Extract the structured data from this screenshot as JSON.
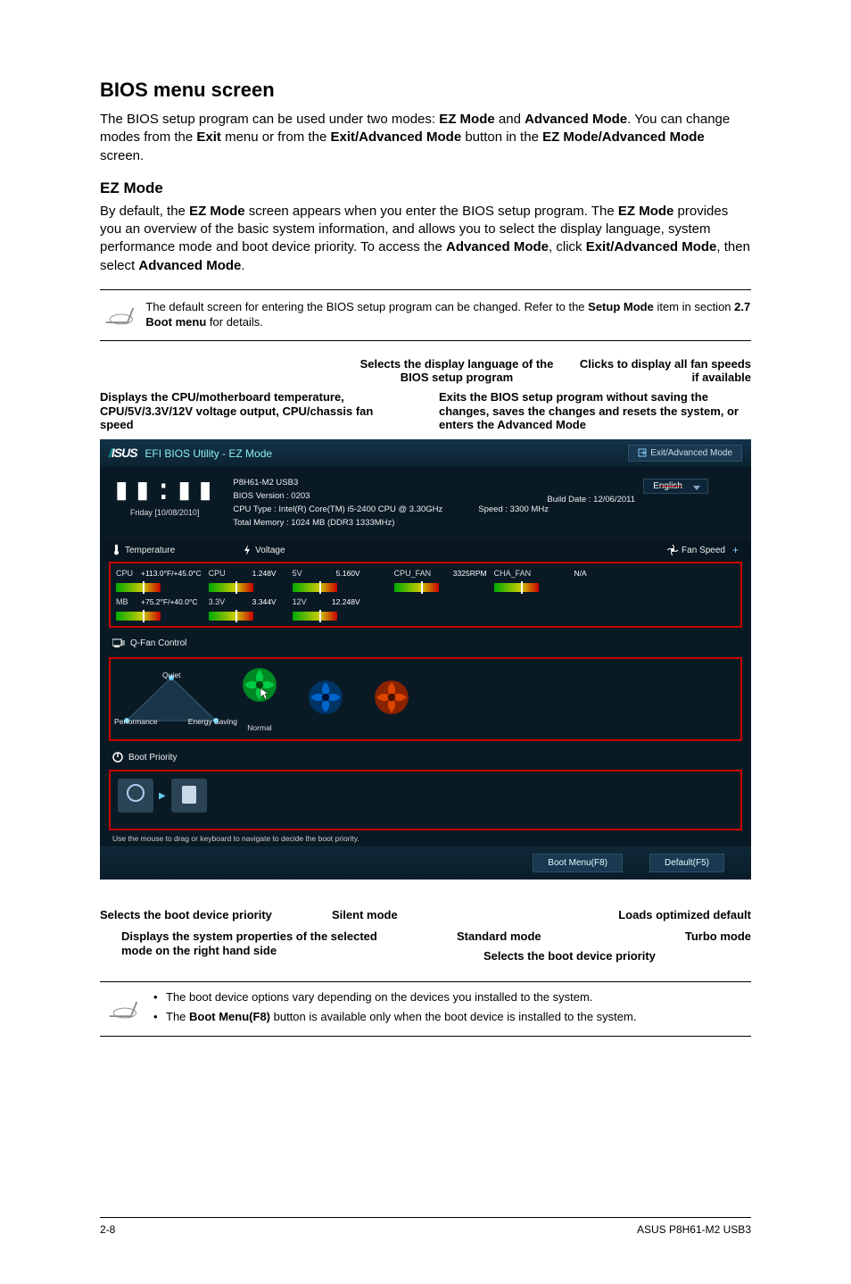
{
  "page": {
    "title": "BIOS menu screen",
    "intro": "The BIOS setup program can be used under two modes: EZ Mode and Advanced Mode. You can change modes from the Exit menu or from the Exit/Advanced Mode button in the EZ Mode/Advanced Mode screen.",
    "ez_title": "EZ Mode",
    "ez_body": "By default, the EZ Mode screen appears when you enter the BIOS setup program. The EZ Mode provides you an overview of the basic system information, and allows you to select the display language, system performance mode and boot device priority. To access the Advanced Mode, click Exit/Advanced Mode, then select Advanced Mode."
  },
  "notes": {
    "top": "The default screen for entering the BIOS setup program can be changed. Refer to the Setup Mode item in section 2.7 Boot menu for details.",
    "bottom": [
      "The boot device options vary depending on the devices you installed to the system.",
      "The Boot Menu(F8) button is available only when the boot device is installed to the system."
    ]
  },
  "callouts": {
    "top_center": "Selects the display language of the BIOS setup program",
    "top_right": "Clicks to display all fan speeds if available",
    "left_block": "Displays the CPU/motherboard temperature, CPU/5V/3.3V/12V voltage output, CPU/chassis fan speed",
    "right_block": "Exits the BIOS setup program without saving the changes, saves the changes and resets the system, or enters the Advanced Mode",
    "boot_priority": "Selects the boot device priority",
    "silent": "Silent mode",
    "standard": "Standard mode",
    "turbo": "Turbo mode",
    "displays_props": "Displays the system properties of the selected mode on the right hand side",
    "loads_default": "Loads optimized default",
    "selects_boot2": "Selects the boot device priority"
  },
  "bios": {
    "brand": "/SUS",
    "header_title": " EFI BIOS Utility - EZ Mode",
    "exit_button": "Exit/Advanced Mode",
    "clock_time": "14:10",
    "clock_date": "Friday [10/08/2010]",
    "model": "P8H61-M2 USB3",
    "bios_version": "BIOS Version : 0203",
    "cpu_type": "CPU Type : Intel(R) Core(TM) i5-2400 CPU @ 3.30GHz",
    "build_date": "Build Date : 12/06/2011",
    "speed": "Speed : 3300 MHz",
    "total_memory": "Total Memory : 1024 MB (DDR3 1333MHz)",
    "language": "English",
    "sensor_headers": {
      "temp": "Temperature",
      "volt": "Voltage",
      "fan": "Fan Speed"
    },
    "temps": {
      "cpu_label": "CPU",
      "cpu_val": "+113.0°F/+45.0°C",
      "mb_label": "MB",
      "mb_val": "+75.2°F/+40.0°C"
    },
    "volts": {
      "cpu_label": "CPU",
      "cpu_val": "1.248V",
      "v33_label": "3.3V",
      "v33_val": "3.344V",
      "v5_label": "5V",
      "v5_val": "5.160V",
      "v12_label": "12V",
      "v12_val": "12.248V"
    },
    "fans": {
      "cpu_label": "CPU_FAN",
      "cpu_val": "3325RPM",
      "cha_label": "CHA_FAN",
      "cha_val": "N/A"
    },
    "qfan_label": "Q-Fan Control",
    "profile": {
      "quiet": "Quiet",
      "performance": "Performance",
      "energy": "Energy Saving",
      "normal": "Normal"
    },
    "boot_priority_label": "Boot Priority",
    "boot_hint": "Use the mouse to drag or keyboard to navigate to decide the boot priority.",
    "footer": {
      "bootmenu": "Boot Menu(F8)",
      "default": "Default(F5)"
    }
  },
  "footer": {
    "left": "2-8",
    "right": "ASUS P8H61-M2 USB3"
  }
}
